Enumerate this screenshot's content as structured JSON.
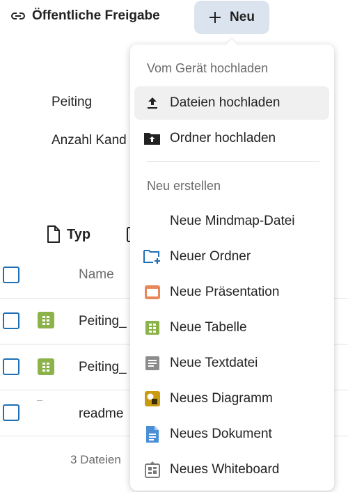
{
  "header": {
    "share_label": "Öffentliche Freigabe",
    "new_label": "Neu",
    "link_icon": "link-icon",
    "plus_icon": "plus-icon"
  },
  "details": {
    "row1": "Peiting",
    "row2": "Anzahl Kand"
  },
  "columns": {
    "type_label": "Typ",
    "name_label": "Name"
  },
  "files": [
    {
      "name": "Peiting_",
      "icon": "spreadsheet-icon"
    },
    {
      "name": "Peiting_",
      "icon": "spreadsheet-icon"
    },
    {
      "name": "readme",
      "icon": "text-file-icon"
    }
  ],
  "footer": {
    "count": "3 Dateien"
  },
  "menu": {
    "section_upload": "Vom Gerät hochladen",
    "section_create": "Neu erstellen",
    "upload_items": [
      {
        "label": "Dateien hochladen",
        "icon": "upload-icon"
      },
      {
        "label": "Ordner hochladen",
        "icon": "folder-upload-icon"
      }
    ],
    "create_items": [
      {
        "label": "Neue Mindmap-Datei",
        "icon": ""
      },
      {
        "label": "Neuer Ordner",
        "icon": "new-folder-icon"
      },
      {
        "label": "Neue Präsentation",
        "icon": "presentation-icon"
      },
      {
        "label": "Neue Tabelle",
        "icon": "spreadsheet-icon"
      },
      {
        "label": "Neue Textdatei",
        "icon": "text-file-icon"
      },
      {
        "label": "Neues Diagramm",
        "icon": "diagram-icon"
      },
      {
        "label": "Neues Dokument",
        "icon": "document-icon"
      },
      {
        "label": "Neues Whiteboard",
        "icon": "whiteboard-icon"
      }
    ]
  },
  "colors": {
    "accent": "#1f6fb5",
    "new_button_bg": "#dbe4ee",
    "spreadsheet": "#8cb34a",
    "presentation": "#e9875a",
    "text_file": "#8c8c8c",
    "diagram": "#c99a12",
    "document": "#4a8fd6",
    "whiteboard": "#7a7a7a"
  }
}
